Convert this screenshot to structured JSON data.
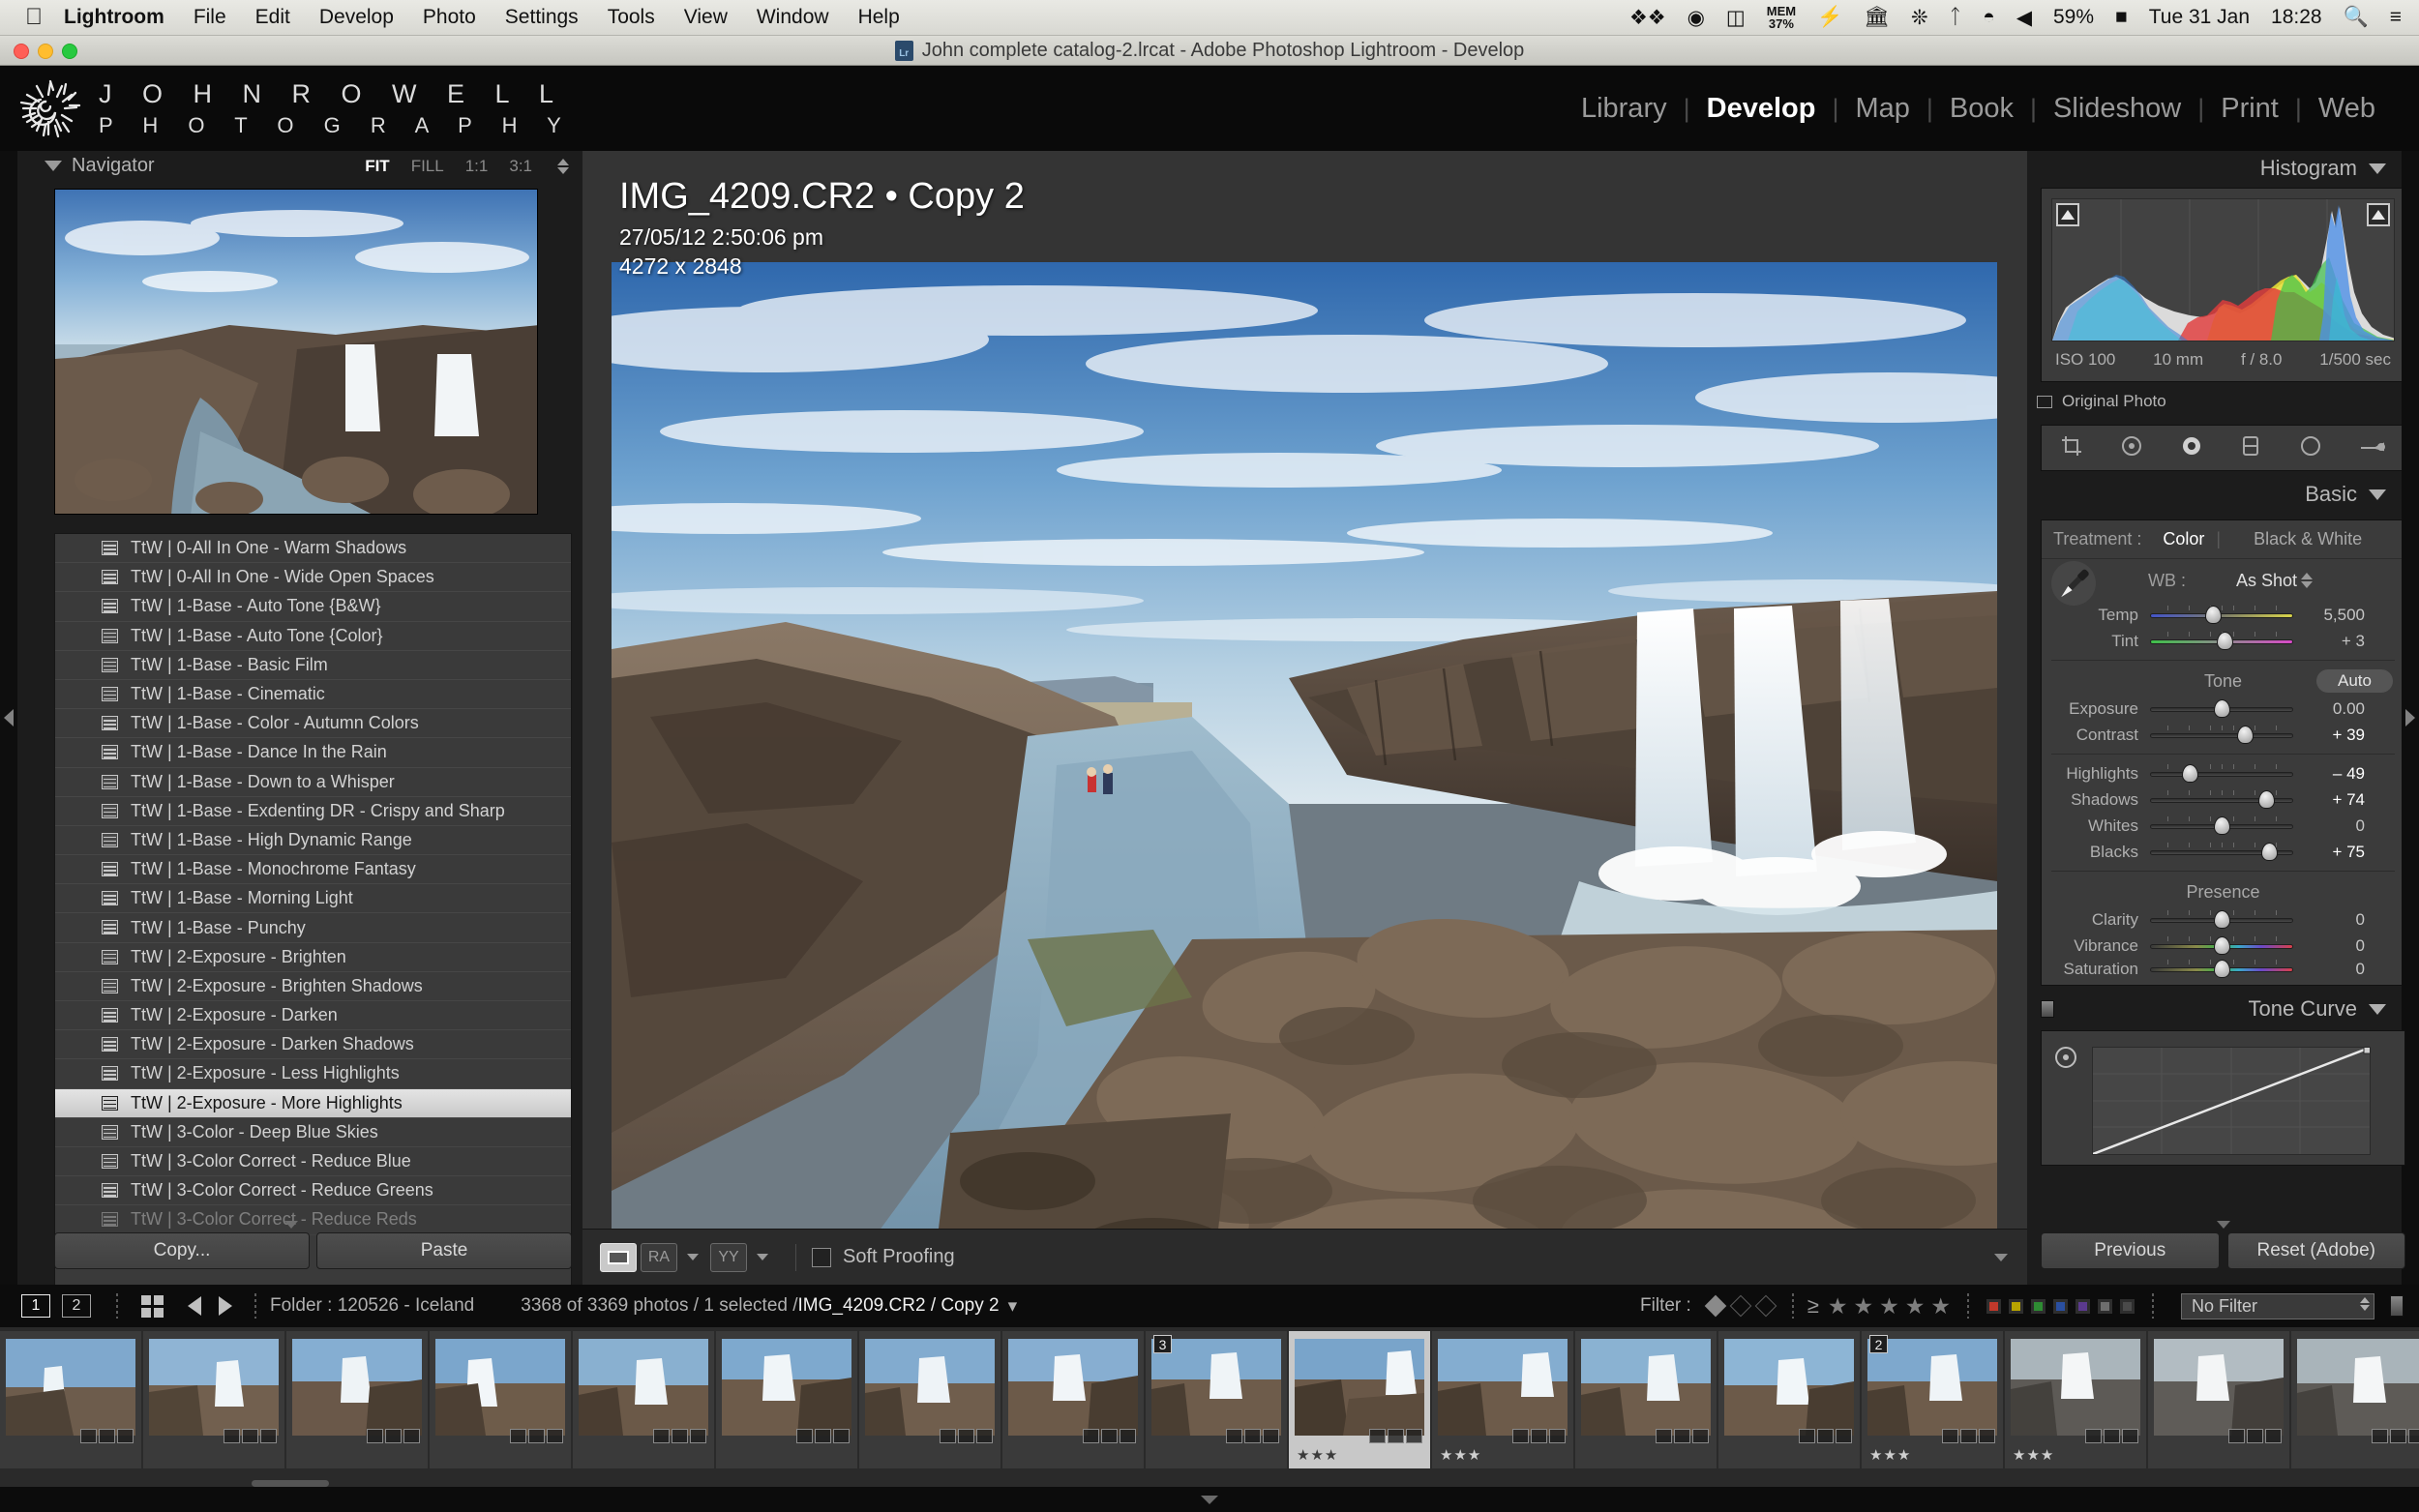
{
  "macbar": {
    "apple_icon": "apple-icon",
    "items": [
      {
        "label": "Lightroom",
        "bold": true
      },
      {
        "label": "File",
        "bold": false
      },
      {
        "label": "Edit",
        "bold": false
      },
      {
        "label": "Develop",
        "bold": false
      },
      {
        "label": "Photo",
        "bold": false
      },
      {
        "label": "Settings",
        "bold": false
      },
      {
        "label": "Tools",
        "bold": false
      },
      {
        "label": "View",
        "bold": false
      },
      {
        "label": "Window",
        "bold": false
      },
      {
        "label": "Help",
        "bold": false
      }
    ],
    "mem_label": "MEM",
    "mem_value": "37%",
    "battery": "59%",
    "date": "Tue 31 Jan",
    "time": "18:28"
  },
  "titlebar": {
    "title": "John complete catalog-2.lrcat - Adobe Photoshop Lightroom - Develop",
    "app_badge": "Lr"
  },
  "identity": {
    "line1": "J O H N   R O W E L L",
    "line2": "P H O T O G R A P H Y"
  },
  "modules": [
    {
      "label": "Library",
      "active": false
    },
    {
      "label": "Develop",
      "active": true
    },
    {
      "label": "Map",
      "active": false
    },
    {
      "label": "Book",
      "active": false
    },
    {
      "label": "Slideshow",
      "active": false
    },
    {
      "label": "Print",
      "active": false
    },
    {
      "label": "Web",
      "active": false
    }
  ],
  "navigator": {
    "title": "Navigator",
    "modes": [
      {
        "label": "FIT",
        "active": true
      },
      {
        "label": "FILL",
        "active": false
      },
      {
        "label": "1:1",
        "active": false
      },
      {
        "label": "3:1",
        "active": false
      }
    ]
  },
  "presets": {
    "items": [
      {
        "label": "TtW | 0-All In One - Warm Shadows",
        "selected": false
      },
      {
        "label": "TtW | 0-All In One - Wide Open Spaces",
        "selected": false
      },
      {
        "label": "TtW | 1-Base - Auto Tone {B&W}",
        "selected": false
      },
      {
        "label": "TtW | 1-Base - Auto Tone {Color}",
        "selected": false
      },
      {
        "label": "TtW | 1-Base - Basic Film",
        "selected": false
      },
      {
        "label": "TtW | 1-Base - Cinematic",
        "selected": false
      },
      {
        "label": "TtW | 1-Base - Color - Autumn Colors",
        "selected": false
      },
      {
        "label": "TtW | 1-Base - Dance In the Rain",
        "selected": false
      },
      {
        "label": "TtW | 1-Base - Down to a Whisper",
        "selected": false
      },
      {
        "label": "TtW | 1-Base - Exdenting DR - Crispy and Sharp",
        "selected": false
      },
      {
        "label": "TtW | 1-Base - High Dynamic Range",
        "selected": false
      },
      {
        "label": "TtW | 1-Base - Monochrome Fantasy",
        "selected": false
      },
      {
        "label": "TtW | 1-Base - Morning Light",
        "selected": false
      },
      {
        "label": "TtW | 1-Base - Punchy",
        "selected": false
      },
      {
        "label": "TtW | 2-Exposure - Brighten",
        "selected": false
      },
      {
        "label": "TtW | 2-Exposure - Brighten Shadows",
        "selected": false
      },
      {
        "label": "TtW | 2-Exposure - Darken",
        "selected": false
      },
      {
        "label": "TtW | 2-Exposure - Darken Shadows",
        "selected": false
      },
      {
        "label": "TtW | 2-Exposure - Less Highlights",
        "selected": false
      },
      {
        "label": "TtW | 2-Exposure - More Highlights",
        "selected": true
      },
      {
        "label": "TtW | 3-Color - Deep Blue Skies",
        "selected": false
      },
      {
        "label": "TtW | 3-Color Correct - Reduce Blue",
        "selected": false
      },
      {
        "label": "TtW | 3-Color Correct - Reduce Greens",
        "selected": false
      },
      {
        "label": "TtW | 3-Color Correct - Reduce Reds",
        "selected": false
      }
    ],
    "copy_label": "Copy...",
    "paste_label": "Paste"
  },
  "photo": {
    "filename": "IMG_4209.CR2  •  Copy 2",
    "datetime": "27/05/12 2:50:06 pm",
    "dimensions": "4272 x 2848"
  },
  "center_toolbar": {
    "soft_proofing_label": "Soft Proofing",
    "view_loupe": "loupe-view-icon",
    "view_ra": "RA",
    "view_yy": "YY"
  },
  "histogram": {
    "title": "Histogram",
    "iso": "ISO 100",
    "focal": "10 mm",
    "aperture": "f / 8.0",
    "shutter": "1/500 sec",
    "original_photo_label": "Original Photo"
  },
  "basic": {
    "title": "Basic",
    "treatment_label": "Treatment :",
    "treatment_color": "Color",
    "treatment_bw": "Black & White",
    "wb_label": "WB :",
    "wb_value": "As Shot",
    "wb_sliders": [
      {
        "name": "Temp",
        "value": "5,500",
        "pos": 44,
        "track": "temp"
      },
      {
        "name": "Tint",
        "value": "+ 3",
        "pos": 52,
        "track": "tint"
      }
    ],
    "tone_label": "Tone",
    "auto_label": "Auto",
    "tone_sliders_top": [
      {
        "name": "Exposure",
        "value": "0.00",
        "pos": 50,
        "track": "plain",
        "ticks": false
      },
      {
        "name": "Contrast",
        "value": "+ 39",
        "pos": 66,
        "track": "plain",
        "ticks": true
      }
    ],
    "tone_sliders_bottom": [
      {
        "name": "Highlights",
        "value": "– 49",
        "pos": 28,
        "track": "plain",
        "ticks": true
      },
      {
        "name": "Shadows",
        "value": "+ 74",
        "pos": 81,
        "track": "plain",
        "ticks": true
      },
      {
        "name": "Whites",
        "value": "0",
        "pos": 50,
        "track": "plain",
        "ticks": true
      },
      {
        "name": "Blacks",
        "value": "+ 75",
        "pos": 83,
        "track": "plain",
        "ticks": true
      }
    ],
    "presence_label": "Presence",
    "presence_sliders": [
      {
        "name": "Clarity",
        "value": "0",
        "pos": 50,
        "track": "plain",
        "ticks": true
      },
      {
        "name": "Vibrance",
        "value": "0",
        "pos": 50,
        "track": "color",
        "ticks": true
      },
      {
        "name": "Saturation",
        "value": "0",
        "pos": 50,
        "track": "color",
        "ticks": true
      }
    ]
  },
  "tone_curve": {
    "title": "Tone Curve"
  },
  "right_buttons": {
    "previous": "Previous",
    "reset": "Reset (Adobe)"
  },
  "filmstrip_bar": {
    "screen1": "1",
    "screen2": "2",
    "folder_label": "Folder : 120526 - Iceland",
    "count_pre": "3368 of 3369 photos / 1 selected /",
    "count_file": "IMG_4209.CR2 / Copy 2",
    "filter_label": "Filter :",
    "rating_op": "≥",
    "no_filter": "No Filter"
  },
  "filmstrip": {
    "cells": [
      {
        "num": "",
        "stars": "",
        "active": false
      },
      {
        "num": "",
        "stars": "",
        "active": false
      },
      {
        "num": "",
        "stars": "",
        "active": false
      },
      {
        "num": "",
        "stars": "",
        "active": false
      },
      {
        "num": "",
        "stars": "",
        "active": false
      },
      {
        "num": "",
        "stars": "",
        "active": false
      },
      {
        "num": "",
        "stars": "",
        "active": false
      },
      {
        "num": "",
        "stars": "",
        "active": false
      },
      {
        "num": "3",
        "stars": "",
        "active": false
      },
      {
        "num": "",
        "stars": "★★★",
        "active": true
      },
      {
        "num": "",
        "stars": "★★★",
        "active": false
      },
      {
        "num": "",
        "stars": "",
        "active": false
      },
      {
        "num": "",
        "stars": "",
        "active": false
      },
      {
        "num": "2",
        "stars": "★★★",
        "active": false
      },
      {
        "num": "",
        "stars": "★★★",
        "active": false
      },
      {
        "num": "",
        "stars": "",
        "active": false
      },
      {
        "num": "",
        "stars": "",
        "active": false
      }
    ]
  },
  "colors": {
    "accent": "#ffffff",
    "panel_bg": "#1c1c1c",
    "slider_bg": "#3b3b3b",
    "selected_row": "#e4e4e4"
  }
}
